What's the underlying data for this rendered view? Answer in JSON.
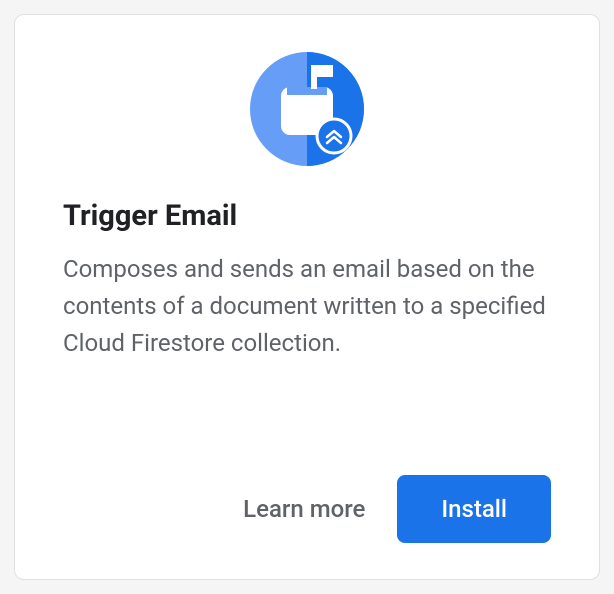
{
  "card": {
    "title": "Trigger Email",
    "description": "Composes and sends an email based on the contents of a document written to a specified Cloud Firestore collection.",
    "actions": {
      "learn_more_label": "Learn more",
      "install_label": "Install"
    }
  }
}
